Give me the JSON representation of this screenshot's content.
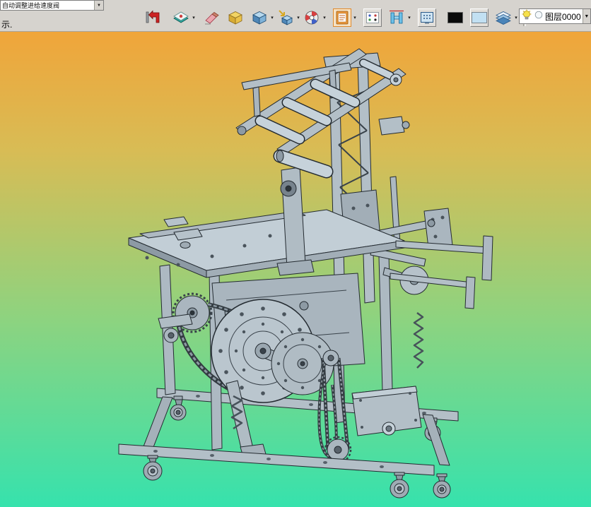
{
  "prompt_bar": {
    "tab_text": "自动调整进给速度阀",
    "hint_text": "示."
  },
  "toolbar": {
    "buttons": [
      {
        "name": "undo-back-button",
        "icon": "back-arrow-icon",
        "dropdown": false
      },
      {
        "name": "render-mode-button",
        "icon": "render-plate-icon",
        "dropdown": true
      },
      {
        "name": "eraser-button",
        "icon": "eraser-icon",
        "dropdown": false
      },
      {
        "name": "view-iso-button",
        "icon": "yellow-cube-icon",
        "dropdown": false
      },
      {
        "name": "view-shaded-button",
        "icon": "blue-cube-icon",
        "dropdown": true
      },
      {
        "name": "view-direction-button",
        "icon": "cube-arrow-icon",
        "dropdown": true
      },
      {
        "name": "color-wheel-button",
        "icon": "color-wheel-icon",
        "dropdown": true
      },
      {
        "name": "material-board-button",
        "icon": "orange-clipboard-icon",
        "dropdown": true,
        "selected": true
      },
      {
        "name": "snap-points-button",
        "icon": "dots-box-icon",
        "dropdown": false,
        "raised": true
      },
      {
        "name": "measure-button",
        "icon": "measure-hbeam-icon",
        "dropdown": true
      },
      {
        "name": "grid-display-button",
        "icon": "grid-screen-icon",
        "dropdown": false,
        "raised": true
      },
      {
        "name": "bg-color-black-button",
        "icon": "black-swatch",
        "dropdown": false
      },
      {
        "name": "bg-color-blue-button",
        "icon": "blue-swatch",
        "dropdown": false,
        "raised": true
      },
      {
        "name": "layers-button",
        "icon": "layers-icon",
        "dropdown": true
      }
    ]
  },
  "layer_panel": {
    "label": "图层0000",
    "icons": [
      "lightbulb-icon",
      "circle-icon",
      "dropdown-arrow"
    ]
  },
  "canvas": {
    "model_name": "carton-packing-machine-3d-model",
    "gradient_top": "#f0a53a",
    "gradient_mid1": "#d8bc55",
    "gradient_mid2": "#8ed37f",
    "gradient_bottom": "#36e2ad",
    "model_body_color": "#b3bfc7",
    "model_edge_color": "#242b31"
  }
}
